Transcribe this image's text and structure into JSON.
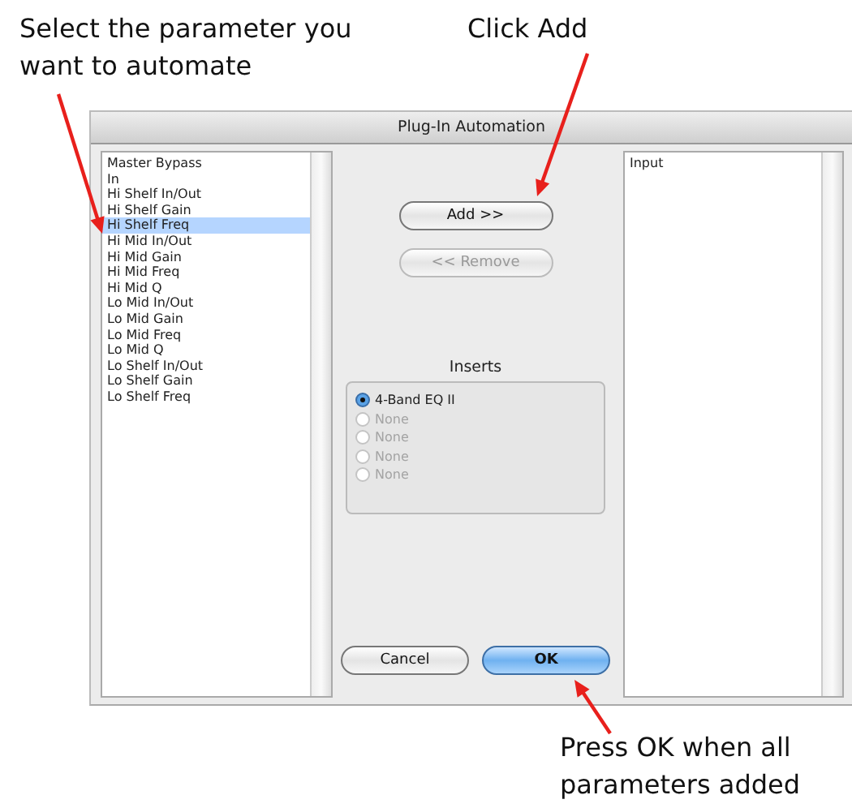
{
  "annotations": [
    {
      "text": "Select the parameter you want to automate"
    },
    {
      "text": "Click Add"
    },
    {
      "text": "Press OK when all parameters added"
    }
  ],
  "window": {
    "title": "Plug-In Automation"
  },
  "parameters": [
    {
      "label": "Master Bypass",
      "selected": false
    },
    {
      "label": "In",
      "selected": false
    },
    {
      "label": "Hi Shelf In/Out",
      "selected": false
    },
    {
      "label": "Hi Shelf Gain",
      "selected": false
    },
    {
      "label": "Hi Shelf Freq",
      "selected": true
    },
    {
      "label": "Hi Mid In/Out",
      "selected": false
    },
    {
      "label": "Hi Mid Gain",
      "selected": false
    },
    {
      "label": "Hi Mid Freq",
      "selected": false
    },
    {
      "label": "Hi Mid Q",
      "selected": false
    },
    {
      "label": "Lo Mid In/Out",
      "selected": false
    },
    {
      "label": "Lo Mid Gain",
      "selected": false
    },
    {
      "label": "Lo Mid Freq",
      "selected": false
    },
    {
      "label": "Lo Mid Q",
      "selected": false
    },
    {
      "label": "Lo Shelf In/Out",
      "selected": false
    },
    {
      "label": "Lo Shelf Gain",
      "selected": false
    },
    {
      "label": "Lo Shelf Freq",
      "selected": false
    }
  ],
  "transfer_buttons": [
    {
      "label": "Add >>",
      "disabled": false
    },
    {
      "label": "<< Remove",
      "disabled": true
    }
  ],
  "inserts": {
    "title": "Inserts",
    "options": [
      {
        "label": "4-Band EQ II",
        "selected": true,
        "disabled": false
      },
      {
        "label": "None",
        "selected": false,
        "disabled": true
      },
      {
        "label": "None",
        "selected": false,
        "disabled": true
      },
      {
        "label": "None",
        "selected": false,
        "disabled": true
      },
      {
        "label": "None",
        "selected": false,
        "disabled": true
      }
    ]
  },
  "actions": [
    {
      "label": "Cancel",
      "default": false
    },
    {
      "label": "OK",
      "default": true
    }
  ],
  "automated": [
    {
      "label": "Input",
      "selected": false
    }
  ]
}
